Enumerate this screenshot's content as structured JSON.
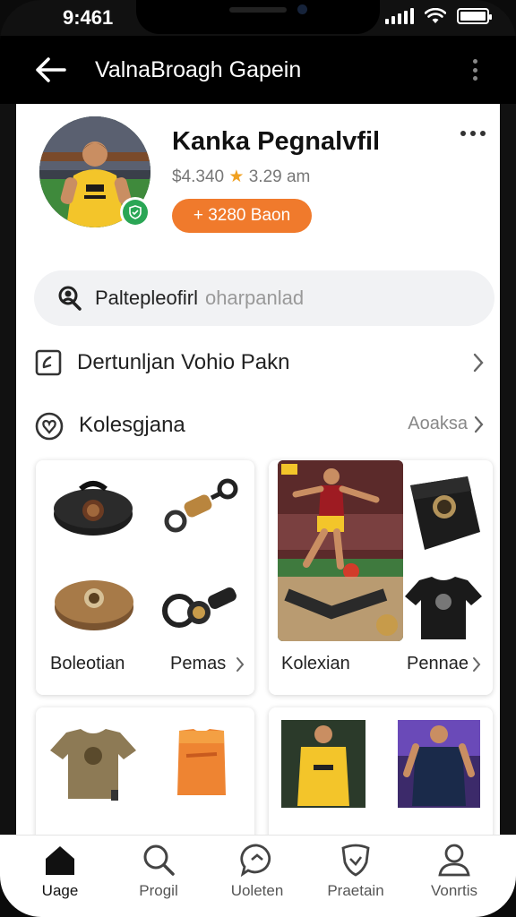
{
  "status_bar": {
    "time": "9:461"
  },
  "app_bar": {
    "title": "ValnaBroagh Gapein"
  },
  "profile": {
    "name": "Kanka Pegnalvfil",
    "meta_count": "$4.340",
    "meta_rating": "★",
    "meta_time": "3.29 am",
    "follow_label": "+ 3280 Baon"
  },
  "search": {
    "value": "Paltepleofirl",
    "placeholder": "oharpanlad"
  },
  "menu_row": {
    "label": "Dertunljan Vohio Pakn"
  },
  "section": {
    "title": "Kolesgjana",
    "action": "Aoaksa"
  },
  "cards": [
    {
      "left_caption": "Boleotian",
      "right_caption": "Pemas"
    },
    {
      "left_caption": "Kolexian",
      "right_caption": "Pennae"
    }
  ],
  "bottom_nav": [
    {
      "label": "Uage",
      "icon": "home-icon"
    },
    {
      "label": "Progil",
      "icon": "search-icon"
    },
    {
      "label": "Uoleten",
      "icon": "chat-icon"
    },
    {
      "label": "Praetain",
      "icon": "shield-icon"
    },
    {
      "label": "Vonrtis",
      "icon": "user-icon"
    }
  ],
  "colors": {
    "accent": "#f07a2c",
    "verified": "#2aa655",
    "jersey": "#f3c52a"
  }
}
